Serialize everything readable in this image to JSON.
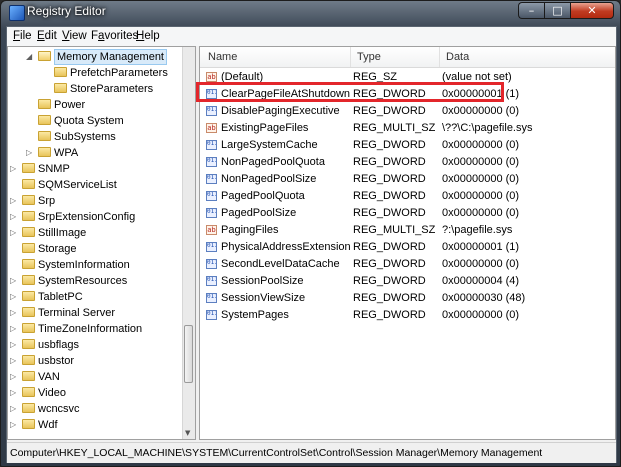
{
  "window": {
    "title": "Registry Editor",
    "min_label": "–",
    "max_label": "□",
    "close_label": "✕"
  },
  "menu": [
    {
      "pre": "",
      "key": "F",
      "post": "ile"
    },
    {
      "pre": "",
      "key": "E",
      "post": "dit"
    },
    {
      "pre": "",
      "key": "V",
      "post": "iew"
    },
    {
      "pre": "F",
      "key": "a",
      "post": "vorites"
    },
    {
      "pre": "",
      "key": "H",
      "post": "elp"
    }
  ],
  "tree": [
    {
      "label": "Memory Management",
      "depth": 2,
      "expander": "◢",
      "selected": true,
      "open": true
    },
    {
      "label": "PrefetchParameters",
      "depth": 3,
      "expander": ""
    },
    {
      "label": "StoreParameters",
      "depth": 3,
      "expander": ""
    },
    {
      "label": "Power",
      "depth": 2,
      "expander": ""
    },
    {
      "label": "Quota System",
      "depth": 2,
      "expander": ""
    },
    {
      "label": "SubSystems",
      "depth": 2,
      "expander": ""
    },
    {
      "label": "WPA",
      "depth": 2,
      "expander": "▷"
    },
    {
      "label": "SNMP",
      "depth": 1,
      "expander": "▷"
    },
    {
      "label": "SQMServiceList",
      "depth": 1,
      "expander": ""
    },
    {
      "label": "Srp",
      "depth": 1,
      "expander": "▷"
    },
    {
      "label": "SrpExtensionConfig",
      "depth": 1,
      "expander": "▷"
    },
    {
      "label": "StillImage",
      "depth": 1,
      "expander": "▷"
    },
    {
      "label": "Storage",
      "depth": 1,
      "expander": ""
    },
    {
      "label": "SystemInformation",
      "depth": 1,
      "expander": ""
    },
    {
      "label": "SystemResources",
      "depth": 1,
      "expander": "▷"
    },
    {
      "label": "TabletPC",
      "depth": 1,
      "expander": "▷"
    },
    {
      "label": "Terminal Server",
      "depth": 1,
      "expander": "▷"
    },
    {
      "label": "TimeZoneInformation",
      "depth": 1,
      "expander": "▷"
    },
    {
      "label": "usbflags",
      "depth": 1,
      "expander": "▷"
    },
    {
      "label": "usbstor",
      "depth": 1,
      "expander": "▷"
    },
    {
      "label": "VAN",
      "depth": 1,
      "expander": "▷"
    },
    {
      "label": "Video",
      "depth": 1,
      "expander": "▷"
    },
    {
      "label": "wcncsvc",
      "depth": 1,
      "expander": "▷"
    },
    {
      "label": "Wdf",
      "depth": 1,
      "expander": "▷"
    }
  ],
  "columns": {
    "name": "Name",
    "type": "Type",
    "data": "Data"
  },
  "values": [
    {
      "name": "(Default)",
      "type": "REG_SZ",
      "data": "(value not set)",
      "icon": "ab"
    },
    {
      "name": "ClearPageFileAtShutdown",
      "type": "REG_DWORD",
      "data": "0x00000001 (1)",
      "icon": "bin",
      "highlighted": true
    },
    {
      "name": "DisablePagingExecutive",
      "type": "REG_DWORD",
      "data": "0x00000000 (0)",
      "icon": "bin"
    },
    {
      "name": "ExistingPageFiles",
      "type": "REG_MULTI_SZ",
      "data": "\\??\\C:\\pagefile.sys",
      "icon": "ab"
    },
    {
      "name": "LargeSystemCache",
      "type": "REG_DWORD",
      "data": "0x00000000 (0)",
      "icon": "bin"
    },
    {
      "name": "NonPagedPoolQuota",
      "type": "REG_DWORD",
      "data": "0x00000000 (0)",
      "icon": "bin"
    },
    {
      "name": "NonPagedPoolSize",
      "type": "REG_DWORD",
      "data": "0x00000000 (0)",
      "icon": "bin"
    },
    {
      "name": "PagedPoolQuota",
      "type": "REG_DWORD",
      "data": "0x00000000 (0)",
      "icon": "bin"
    },
    {
      "name": "PagedPoolSize",
      "type": "REG_DWORD",
      "data": "0x00000000 (0)",
      "icon": "bin"
    },
    {
      "name": "PagingFiles",
      "type": "REG_MULTI_SZ",
      "data": "?:\\pagefile.sys",
      "icon": "ab"
    },
    {
      "name": "PhysicalAddressExtension",
      "type": "REG_DWORD",
      "data": "0x00000001 (1)",
      "icon": "bin"
    },
    {
      "name": "SecondLevelDataCache",
      "type": "REG_DWORD",
      "data": "0x00000000 (0)",
      "icon": "bin"
    },
    {
      "name": "SessionPoolSize",
      "type": "REG_DWORD",
      "data": "0x00000004 (4)",
      "icon": "bin"
    },
    {
      "name": "SessionViewSize",
      "type": "REG_DWORD",
      "data": "0x00000030 (48)",
      "icon": "bin"
    },
    {
      "name": "SystemPages",
      "type": "REG_DWORD",
      "data": "0x00000000 (0)",
      "icon": "bin"
    }
  ],
  "status": {
    "path": "Computer\\HKEY_LOCAL_MACHINE\\SYSTEM\\CurrentControlSet\\Control\\Session Manager\\Memory Management"
  },
  "colors": {
    "highlight_border": "#e3262b",
    "selection": "#d8eaf9"
  }
}
